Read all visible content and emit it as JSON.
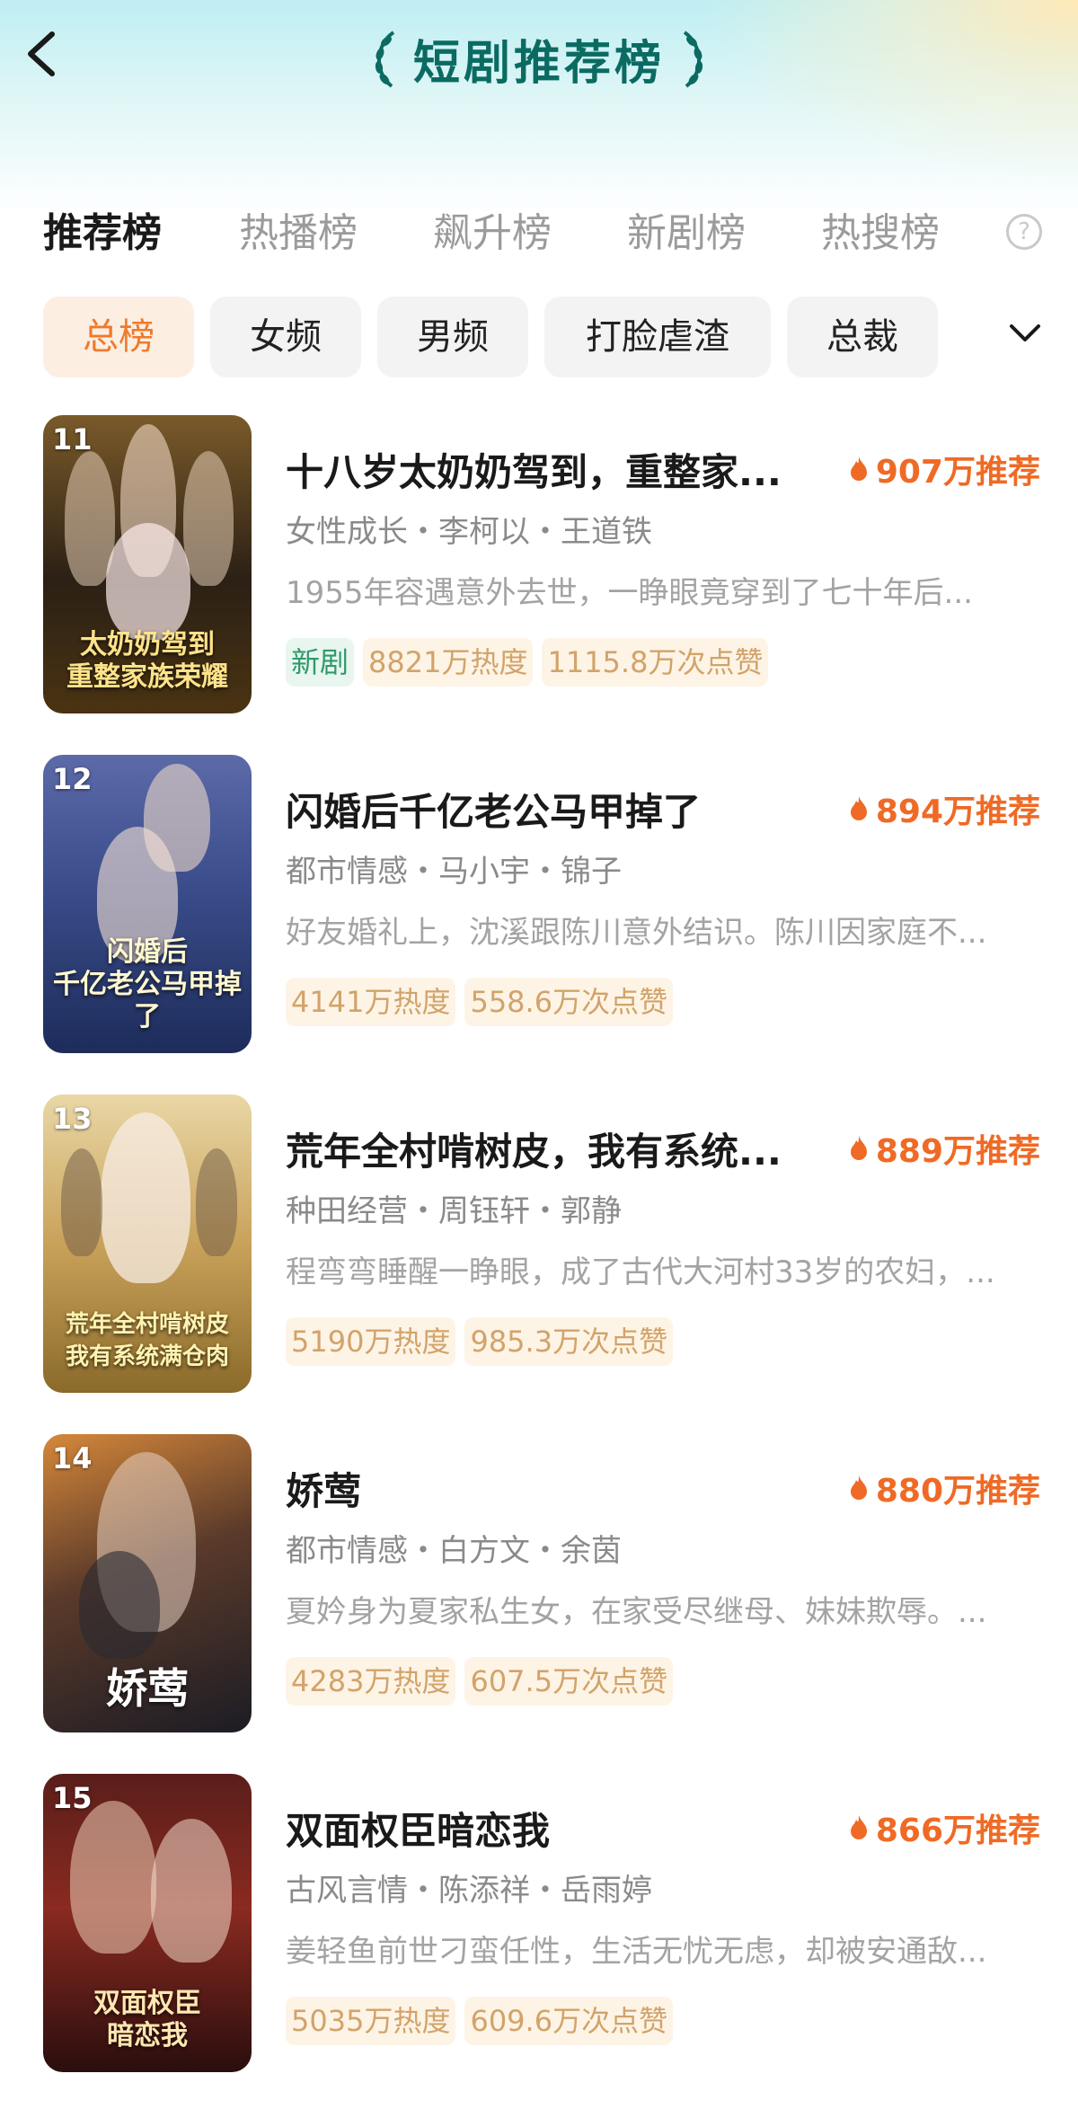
{
  "header": {
    "title": "短剧推荐榜",
    "back_icon": "chevron-left-icon"
  },
  "tabs": [
    {
      "label": "推荐榜",
      "active": true
    },
    {
      "label": "热播榜",
      "active": false
    },
    {
      "label": "飙升榜",
      "active": false
    },
    {
      "label": "新剧榜",
      "active": false
    },
    {
      "label": "热搜榜",
      "active": false
    }
  ],
  "help_label": "?",
  "chips": [
    {
      "label": "总榜",
      "active": true
    },
    {
      "label": "女频",
      "active": false
    },
    {
      "label": "男频",
      "active": false
    },
    {
      "label": "打脸虐渣",
      "active": false
    },
    {
      "label": "总裁",
      "active": false
    }
  ],
  "colors": {
    "accent_orange": "#ef6a25",
    "title_teal": "#0b6b63",
    "tag_bg": "#fdf4e6",
    "tag_text": "#d2a36a",
    "new_tag_bg": "#e8f6ef",
    "new_tag_text": "#2f9a6a"
  },
  "items": [
    {
      "rank": "11",
      "title": "十八岁太奶奶驾到，重整家...",
      "recommend": "907万推荐",
      "meta": "女性成长・李柯以・王道铁",
      "desc": "1955年容遇意外去世，一睁眼竟穿到了七十年后...",
      "new_tag": "新剧",
      "heat": "8821万热度",
      "likes": "1115.8万次点赞",
      "poster_caption": "太奶奶驾到\n重整家族荣耀"
    },
    {
      "rank": "12",
      "title": "闪婚后千亿老公马甲掉了",
      "recommend": "894万推荐",
      "meta": "都市情感・马小宇・锦子",
      "desc": "好友婚礼上，沈溪跟陈川意外结识。陈川因家庭不...",
      "heat": "4141万热度",
      "likes": "558.6万次点赞",
      "poster_caption": "闪婚后\n千亿老公马甲掉了"
    },
    {
      "rank": "13",
      "title": "荒年全村啃树皮，我有系统...",
      "recommend": "889万推荐",
      "meta": "种田经营・周钰轩・郭静",
      "desc": "程弯弯睡醒一睁眼，成了古代大河村33岁的农妇，...",
      "heat": "5190万热度",
      "likes": "985.3万次点赞",
      "poster_caption": "荒年全村啃树皮\n我有系统满仓肉"
    },
    {
      "rank": "14",
      "title": "娇莺",
      "recommend": "880万推荐",
      "meta": "都市情感・白方文・余茵",
      "desc": "夏妗身为夏家私生女，在家受尽继母、妹妹欺辱。...",
      "heat": "4283万热度",
      "likes": "607.5万次点赞",
      "poster_caption": "娇莺"
    },
    {
      "rank": "15",
      "title": "双面权臣暗恋我",
      "recommend": "866万推荐",
      "meta": "古风言情・陈添祥・岳雨婷",
      "desc": "姜轻鱼前世刁蛮任性，生活无忧无虑，却被安通敌...",
      "heat": "5035万热度",
      "likes": "609.6万次点赞",
      "poster_caption": "双面权臣\n暗恋我"
    }
  ]
}
